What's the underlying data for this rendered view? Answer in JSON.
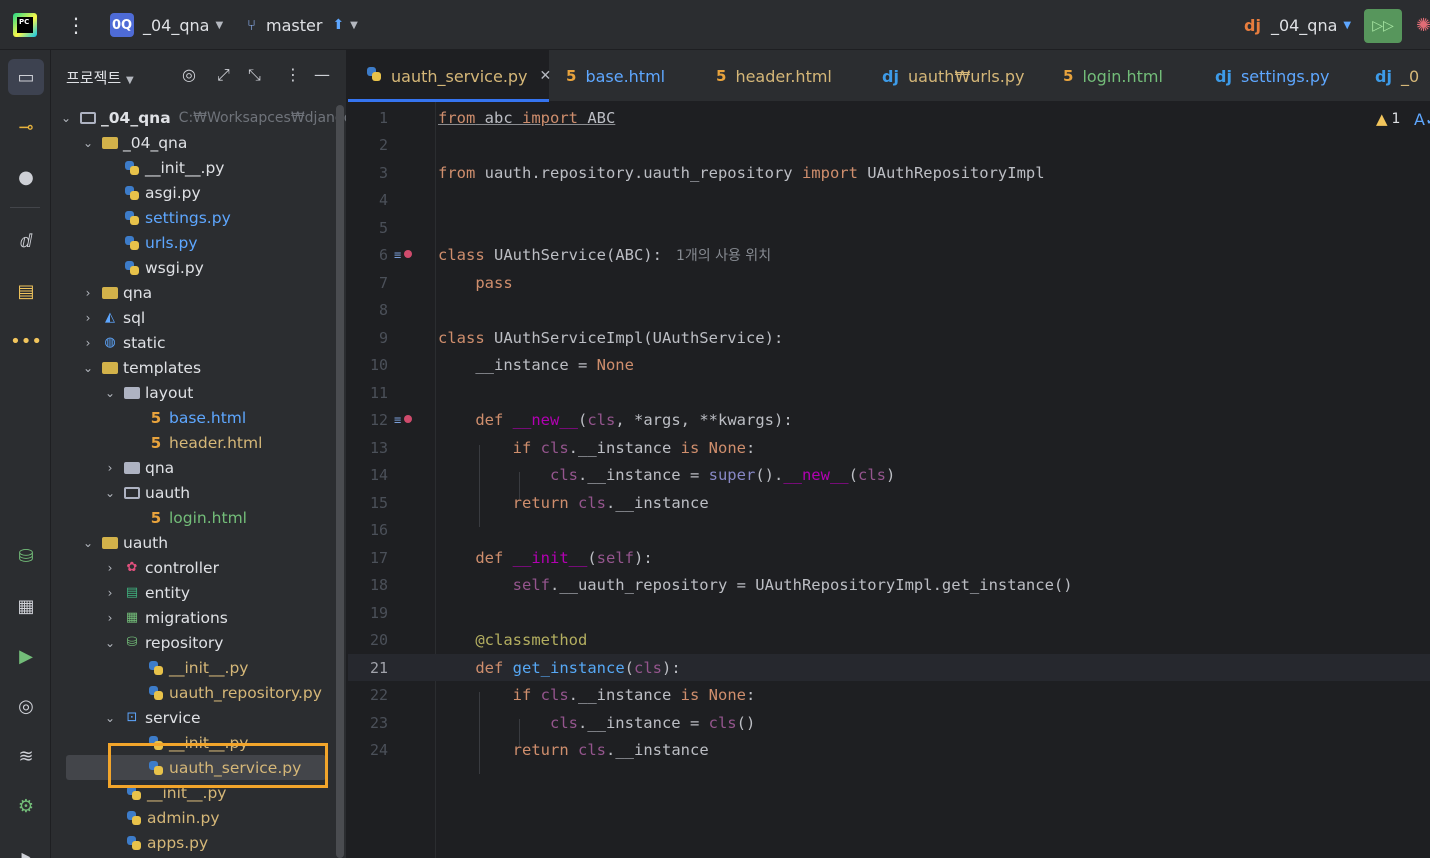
{
  "titlebar": {
    "app_logo": "PC",
    "project_badge": "0Q",
    "project_name": "_04_qna",
    "branch": "master",
    "run_config": "_04_qna",
    "icons": [
      "pycharm-logo",
      "kebab-menu-icon",
      "branch-icon",
      "push-arrow-icon",
      "chevron-down-icon",
      "django-icon",
      "run-icon",
      "debug-icon"
    ]
  },
  "project_panel": {
    "title": "프로젝트",
    "root_name": "_04_qna",
    "root_path": "C:₩Worksapces₩django",
    "items": [
      {
        "label": "_04_qna",
        "color": "normal"
      },
      {
        "label": "__init__.py",
        "color": "normal"
      },
      {
        "label": "asgi.py",
        "color": "normal"
      },
      {
        "label": "settings.py",
        "color": "blue"
      },
      {
        "label": "urls.py",
        "color": "blue"
      },
      {
        "label": "wsgi.py",
        "color": "normal"
      },
      {
        "label": "qna",
        "color": "normal"
      },
      {
        "label": "sql",
        "color": "normal"
      },
      {
        "label": "static",
        "color": "normal"
      },
      {
        "label": "templates",
        "color": "normal"
      },
      {
        "label": "layout",
        "color": "normal"
      },
      {
        "label": "base.html",
        "color": "blue"
      },
      {
        "label": "header.html",
        "color": "yellow"
      },
      {
        "label": "qna",
        "color": "normal"
      },
      {
        "label": "uauth",
        "color": "normal"
      },
      {
        "label": "login.html",
        "color": "green"
      },
      {
        "label": "uauth",
        "color": "normal"
      },
      {
        "label": "controller",
        "color": "normal"
      },
      {
        "label": "entity",
        "color": "normal"
      },
      {
        "label": "migrations",
        "color": "normal"
      },
      {
        "label": "repository",
        "color": "normal"
      },
      {
        "label": "__init__.py",
        "color": "yellow"
      },
      {
        "label": "uauth_repository.py",
        "color": "yellow"
      },
      {
        "label": "service",
        "color": "normal"
      },
      {
        "label": "__init__.py",
        "color": "yellow"
      },
      {
        "label": "uauth_service.py",
        "color": "yellow"
      },
      {
        "label": "__init__.py",
        "color": "yellow"
      },
      {
        "label": "admin.py",
        "color": "yellow"
      },
      {
        "label": "apps.py",
        "color": "yellow"
      }
    ]
  },
  "tabs": [
    {
      "label": "uauth_service.py",
      "icon": "python-icon",
      "active": true
    },
    {
      "label": "base.html",
      "icon": "html-icon"
    },
    {
      "label": "header.html",
      "icon": "html-icon"
    },
    {
      "label": "uauth₩urls.py",
      "icon": "django-icon"
    },
    {
      "label": "login.html",
      "icon": "html-icon"
    },
    {
      "label": "settings.py",
      "icon": "django-icon"
    },
    {
      "label": "_0",
      "icon": "django-icon"
    }
  ],
  "editor": {
    "warning_count": "1",
    "usage_hint": "1개의 사용 위치",
    "line_numbers": [
      "1",
      "2",
      "3",
      "4",
      "5",
      "6",
      "7",
      "8",
      "9",
      "10",
      "11",
      "12",
      "13",
      "14",
      "15",
      "16",
      "17",
      "18",
      "19",
      "20",
      "21",
      "22",
      "23",
      "24"
    ],
    "current_line": "21"
  },
  "colors": {
    "background": "#1e1f22",
    "panel": "#2b2d30",
    "keyword": "#cf8e6d",
    "function": "#56a8f5",
    "highlight_box": "#f2a52b"
  }
}
